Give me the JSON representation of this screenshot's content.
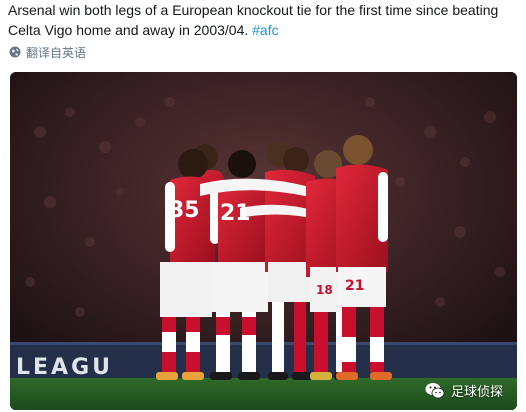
{
  "tweet": {
    "text_line1": "Arsenal win both legs of a European knockout tie for the first time since beating",
    "text_line2_main": "Celta Vigo home and away in 2003/04. ",
    "hashtag": "#afc",
    "translate_label": "翻译自英语"
  },
  "photo": {
    "board_text": "LEAGU",
    "jersey_numbers": [
      "35",
      "21",
      "21",
      "18"
    ],
    "watermark": "足球侦探"
  },
  "colors": {
    "hashtag": "#1b95e0",
    "text": "#14171a",
    "meta": "#657786",
    "arsenal_red": "#c8102e"
  },
  "icons": {
    "translate": "globe-icon",
    "watermark": "wechat-icon"
  }
}
